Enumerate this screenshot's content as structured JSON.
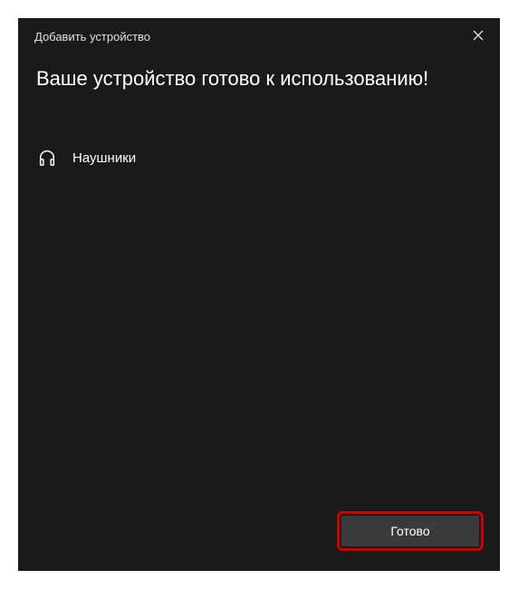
{
  "dialog": {
    "title": "Добавить устройство",
    "heading": "Ваше устройство готово к использованию!",
    "device": {
      "icon": "headphones-icon",
      "name": "Наушники"
    },
    "done_label": "Готово"
  }
}
